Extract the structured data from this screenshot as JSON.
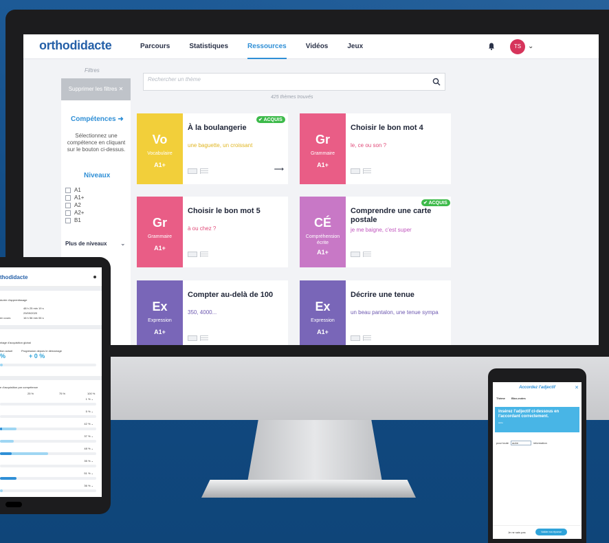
{
  "nav": {
    "logo": "orthodidacte",
    "links": [
      "Parcours",
      "Statistiques",
      "Ressources",
      "Vidéos",
      "Jeux"
    ],
    "avatar_initials": "TS"
  },
  "sidebar": {
    "filters_label": "Filtres",
    "clear_filters": "Supprimer les filtres",
    "competences_title": "Compétences",
    "competences_desc": "Sélectionnez une compétence en cliquant sur le bouton ci-dessus.",
    "levels_title": "Niveaux",
    "levels": [
      "A1",
      "A1+",
      "A2",
      "A2+",
      "B1"
    ],
    "more_levels": "Plus de niveaux"
  },
  "search": {
    "placeholder": "Rechercher un thème",
    "results_count": "425 thèmes trouvés"
  },
  "cards": [
    {
      "abbr": "Vo",
      "domain": "Vocabulaire",
      "level": "A1+",
      "title": "À la boulangerie",
      "subtitle": "une baguette, un croissant",
      "color": "#f2cf3a",
      "sub_color": "#e0b520",
      "acquis": "ACQUIS"
    },
    {
      "abbr": "Gr",
      "domain": "Grammaire",
      "level": "A1+",
      "title": "Choisir le bon mot 4",
      "subtitle": "le, ce ou son ?",
      "color": "#e95d86",
      "sub_color": "#e04a78"
    },
    {
      "abbr": "Gr",
      "domain": "Grammaire",
      "level": "A1+",
      "title": "Choisir le bon mot 5",
      "subtitle": "à ou chez ?",
      "color": "#e95d86",
      "sub_color": "#e04a78"
    },
    {
      "abbr": "CÉ",
      "domain": "Compréhension écrite",
      "level": "A1+",
      "title": "Comprendre une carte postale",
      "subtitle": "je me baigne, c'est super",
      "color": "#c878c6",
      "sub_color": "#c053bd",
      "acquis": "ACQUIS"
    },
    {
      "abbr": "Ex",
      "domain": "Expression",
      "level": "A1+",
      "title": "Compter au-delà de 100",
      "subtitle": "350, 4000...",
      "color": "#7966b8",
      "sub_color": "#6d58b0"
    },
    {
      "abbr": "Ex",
      "domain": "Expression",
      "level": "A1+",
      "title": "Décrire une tenue",
      "subtitle": "un beau pantalon, une tenue sympa",
      "color": "#7966b8",
      "sub_color": "#6d58b0"
    }
  ],
  "tablet": {
    "logo": "thodidacte",
    "duration_title": "durée d'apprentissage",
    "duration_total": "48 h 25 min 19 s",
    "start_date": "29/09/2020",
    "in_progress_label": "en cours",
    "in_progress_time": "16 h 56 min 06 s",
    "global_title": "ntage d'acquisition global",
    "current_label": "tion actuel",
    "progress_label": "Progression depuis le démarrage",
    "current_value": "%",
    "progress_value": "+ 0 %",
    "per_skill_title": "e d'acquisition par compétence",
    "scale": [
      "25 %",
      "75 %",
      "100 %"
    ],
    "rows": [
      {
        "pct": "1 %",
        "fill": 0,
        "fill2": 0
      },
      {
        "pct": "5 %",
        "fill": 0,
        "fill2": 0
      },
      {
        "pct": "42 %",
        "fill": 3,
        "fill2": 24
      },
      {
        "pct": "37 %",
        "fill": 0,
        "fill2": 20
      },
      {
        "pct": "48 %",
        "fill": 17,
        "fill2": 70
      },
      {
        "pct": "35 %",
        "fill": 0,
        "fill2": 0
      },
      {
        "pct": "51 %",
        "fill": 24,
        "fill2": 24
      },
      {
        "pct": "36 %",
        "fill": 0,
        "fill2": 4
      }
    ]
  },
  "phone": {
    "title": "Accordez l'adjectif",
    "tabs": [
      "Thème",
      "Bloc-notes"
    ],
    "instruction": "Insérez l'adjectif ci-dessous en l'accordant correctement.",
    "word": "autre",
    "sentence_before": "pour toute",
    "input_value": "autre",
    "sentence_after": "information",
    "skip": "Je ne sais pas",
    "validate": "Valider ma réponse"
  }
}
